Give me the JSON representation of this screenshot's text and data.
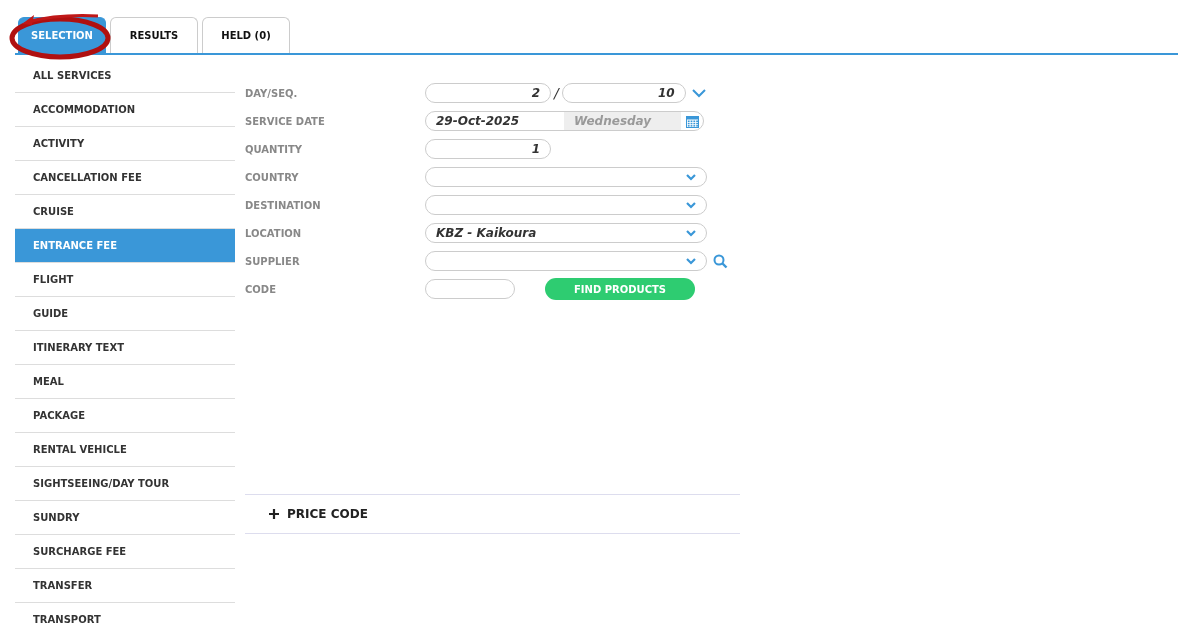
{
  "tabs": [
    {
      "label": "SELECTION",
      "selected": true
    },
    {
      "label": "RESULTS",
      "selected": false
    },
    {
      "label": "HELD (0)",
      "selected": false
    }
  ],
  "sidebar": {
    "items": [
      {
        "label": "ALL SERVICES",
        "selected": false
      },
      {
        "label": "ACCOMMODATION",
        "selected": false
      },
      {
        "label": "ACTIVITY",
        "selected": false
      },
      {
        "label": "CANCELLATION FEE",
        "selected": false
      },
      {
        "label": "CRUISE",
        "selected": false
      },
      {
        "label": "ENTRANCE FEE",
        "selected": true
      },
      {
        "label": "FLIGHT",
        "selected": false
      },
      {
        "label": "GUIDE",
        "selected": false
      },
      {
        "label": "ITINERARY TEXT",
        "selected": false
      },
      {
        "label": "MEAL",
        "selected": false
      },
      {
        "label": "PACKAGE",
        "selected": false
      },
      {
        "label": "RENTAL VEHICLE",
        "selected": false
      },
      {
        "label": "SIGHTSEEING/DAY TOUR",
        "selected": false
      },
      {
        "label": "SUNDRY",
        "selected": false
      },
      {
        "label": "SURCHARGE FEE",
        "selected": false
      },
      {
        "label": "TRANSFER",
        "selected": false
      },
      {
        "label": "TRANSPORT",
        "selected": false
      }
    ]
  },
  "form": {
    "fields": [
      {
        "kind": "pair",
        "label": "DAY/SEQ.",
        "value": "2",
        "separator": "/",
        "value_2": "10"
      },
      {
        "kind": "date",
        "label": "SERVICE DATE",
        "value": "29-Oct-2025",
        "weekday": "Wednesday"
      },
      {
        "kind": "number",
        "label": "QUANTITY",
        "value": "1"
      },
      {
        "kind": "select",
        "label": "COUNTRY"
      },
      {
        "kind": "select",
        "label": "DESTINATION"
      },
      {
        "kind": "select",
        "label": "LOCATION",
        "value": "KBZ - Kaikoura"
      },
      {
        "kind": "select",
        "label": "SUPPLIER",
        "search": true
      },
      {
        "kind": "code",
        "label": "CODE",
        "button": "FIND PRODUCTS"
      }
    ]
  },
  "price_code": {
    "label": "PRICE CODE",
    "expanded": false
  }
}
